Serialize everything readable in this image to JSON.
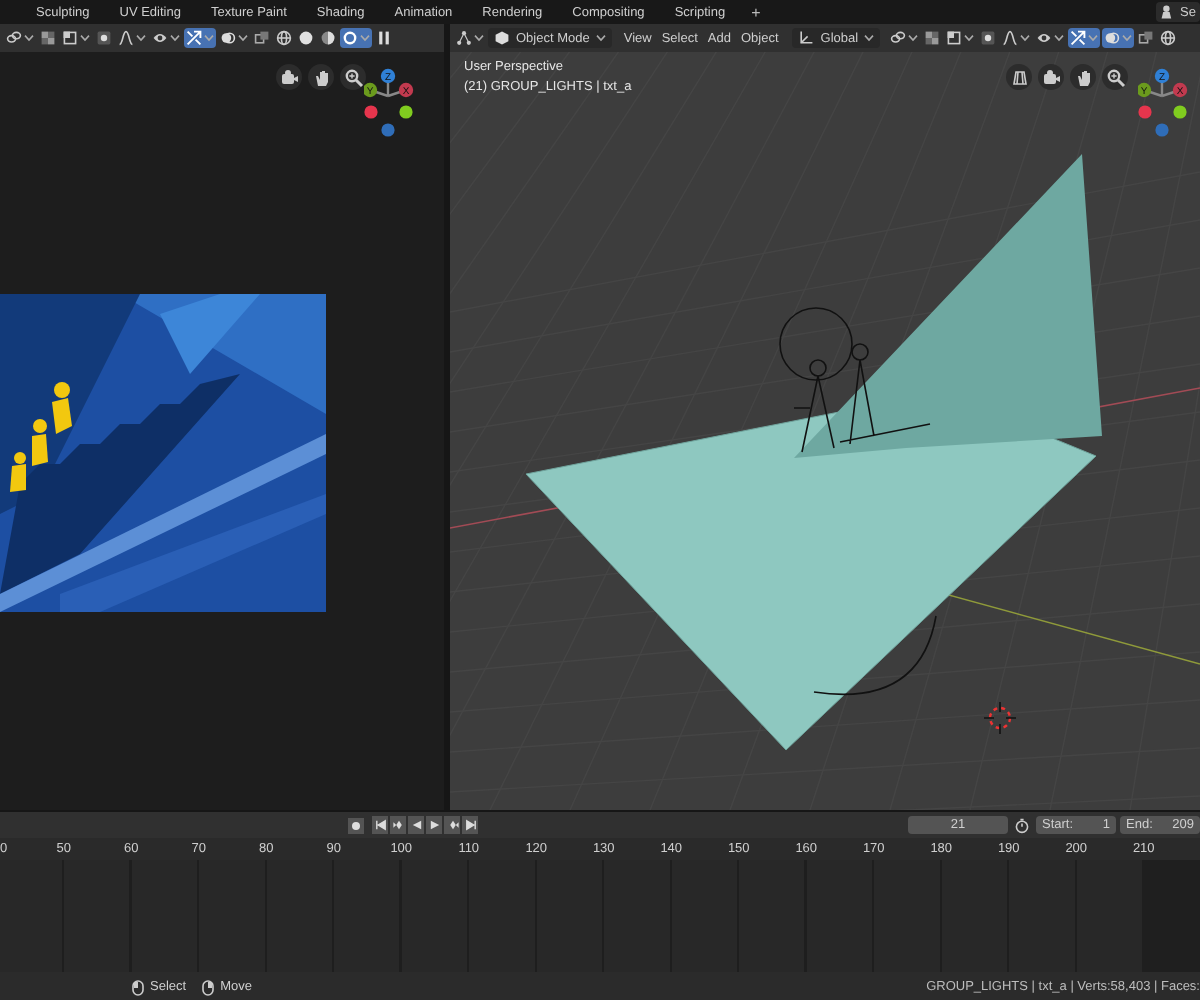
{
  "top_bar": {
    "workspace_tabs": [
      {
        "label": "Sculpting",
        "selected": false
      },
      {
        "label": "UV Editing",
        "selected": false
      },
      {
        "label": "Texture Paint",
        "selected": false
      },
      {
        "label": "Shading",
        "selected": false
      },
      {
        "label": "Animation",
        "selected": false
      },
      {
        "label": "Rendering",
        "selected": false
      },
      {
        "label": "Compositing",
        "selected": false
      },
      {
        "label": "Scripting",
        "selected": false
      }
    ],
    "add_tab": "+",
    "scene": "Se"
  },
  "left_editor": {
    "header_tools": [
      {
        "kind": "link",
        "on": false,
        "menu": true
      },
      {
        "kind": "checker",
        "on": false,
        "menu": false
      },
      {
        "kind": "bracket",
        "on": false,
        "menu": true
      },
      {
        "kind": "target",
        "on": false,
        "menu": false
      },
      {
        "kind": "curve",
        "on": false,
        "menu": true
      },
      {
        "kind": "eye",
        "on": false,
        "menu": true
      },
      {
        "kind": "arrows",
        "on": true,
        "menu": true
      },
      {
        "kind": "circles",
        "on": false,
        "menu": true
      },
      {
        "kind": "squares",
        "on": false,
        "menu": false
      },
      {
        "kind": "wire",
        "on": false,
        "menu": false
      },
      {
        "kind": "solid",
        "on": false,
        "menu": false
      },
      {
        "kind": "material",
        "on": false,
        "menu": false
      },
      {
        "kind": "rendered",
        "on": true,
        "menu": true
      },
      {
        "kind": "pause",
        "on": false,
        "menu": false
      }
    ],
    "gizmo": {
      "axes": [
        "Z",
        "Y",
        "X"
      ]
    }
  },
  "viewport": {
    "header_tools_left": [
      {
        "kind": "nodes",
        "on": false,
        "menu": true
      }
    ],
    "mode": "Object Mode",
    "menus": [
      "View",
      "Select",
      "Add",
      "Object"
    ],
    "orientation": "Global",
    "header_tools": [
      {
        "kind": "link",
        "on": false,
        "menu": true
      },
      {
        "kind": "checker",
        "on": false,
        "menu": false
      },
      {
        "kind": "bracket",
        "on": false,
        "menu": true
      },
      {
        "kind": "target",
        "on": false,
        "menu": false
      },
      {
        "kind": "curve",
        "on": false,
        "menu": true
      },
      {
        "kind": "eye",
        "on": false,
        "menu": true
      },
      {
        "kind": "arrows",
        "on": true,
        "menu": true
      },
      {
        "kind": "circles",
        "on": true,
        "menu": true
      },
      {
        "kind": "squares",
        "on": false,
        "menu": false
      },
      {
        "kind": "wire",
        "on": false,
        "menu": false
      }
    ],
    "overlay_text": [
      "User Perspective",
      "(21) GROUP_LIGHTS | txt_a"
    ],
    "gizmo": {
      "axes": [
        "Z",
        "Y",
        "X"
      ]
    }
  },
  "timeline": {
    "current_frame": "21",
    "start_label": "Start:",
    "start": "1",
    "end_label": "End:",
    "end": "209",
    "ruler": [
      "0",
      "50",
      "60",
      "70",
      "80",
      "90",
      "100",
      "110",
      "120",
      "130",
      "140",
      "150",
      "160",
      "170",
      "180",
      "190",
      "200",
      "210"
    ]
  },
  "status_bar": {
    "hints": [
      "Select",
      "Move"
    ],
    "stats": "GROUP_LIGHTS | txt_a | Verts:58,403 | Faces:"
  }
}
